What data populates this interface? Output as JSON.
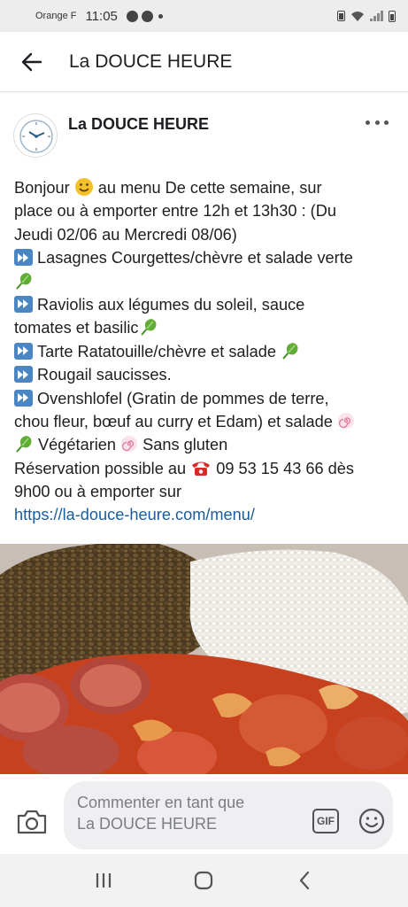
{
  "status_bar": {
    "carrier": "Orange F",
    "time": "11:05"
  },
  "header": {
    "back_icon": "arrow-left-icon",
    "title": "La DOUCE HEURE"
  },
  "post": {
    "page_name": "La DOUCE HEURE",
    "avatar_icon": "clock-icon",
    "text": {
      "l1a": "Bonjour ",
      "l1b": " au menu De cette semaine, sur",
      "l2": "place ou à emporter entre 12h et 13h30 : (Du",
      "l3": "Jeudi 02/06 au Mercredi 08/06)",
      "l4": "Lasagnes Courgettes/chèvre et salade verte",
      "l6": "Raviolis aux légumes du soleil, sauce",
      "l7": "tomates et basilic",
      "l8": "Tarte Ratatouille/chèvre et salade ",
      "l9": "Rougail saucisses.",
      "l10": "Ovenshlofel (Gratin de pommes de terre,",
      "l11": "chou fleur, bœuf au curry et Edam) et salade ",
      "l12a": " Végétarien ",
      "l12b": " Sans gluten",
      "l13a": "Réservation possible au ",
      "l13b": " 09 53 15 43 66 dès",
      "l14": "9h00 ou à emporter sur",
      "link": "https://la-douce-heure.com/menu/"
    },
    "image_alt_icon": "food-photo"
  },
  "comment": {
    "placeholder_line1": "Commenter en tant que",
    "placeholder_line2": "La DOUCE HEURE",
    "gif_label": "GIF"
  },
  "colors": {
    "link": "#1a5c9e",
    "fast_forward": "#4b86c4",
    "input_bg": "#efeff1"
  }
}
